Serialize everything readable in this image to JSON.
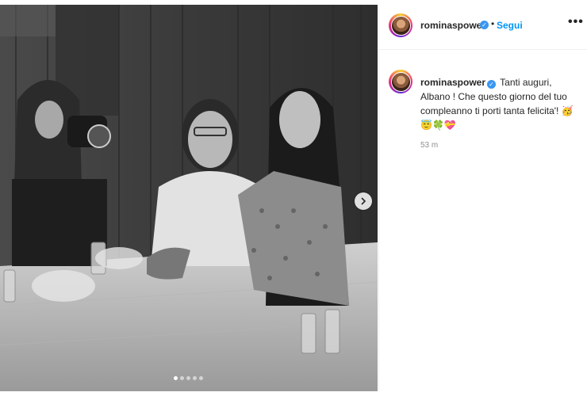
{
  "header": {
    "username": "rominaspower",
    "follow_label": "Segui",
    "more_label": "•••",
    "separator": "•"
  },
  "caption": {
    "username": "rominaspower",
    "text": "Tanti auguri, Albano ! Che questo giorno del tuo compleanno ti porti tanta felicita'! 🥳😇🍀💝",
    "time": "53 m"
  },
  "carousel": {
    "dots": 5,
    "active_index": 0
  },
  "colors": {
    "follow": "#0095f6",
    "verified": "#3897f0"
  },
  "icons": {
    "verified": "verified-badge-icon",
    "next": "chevron-right-icon",
    "more": "more-options-icon"
  }
}
